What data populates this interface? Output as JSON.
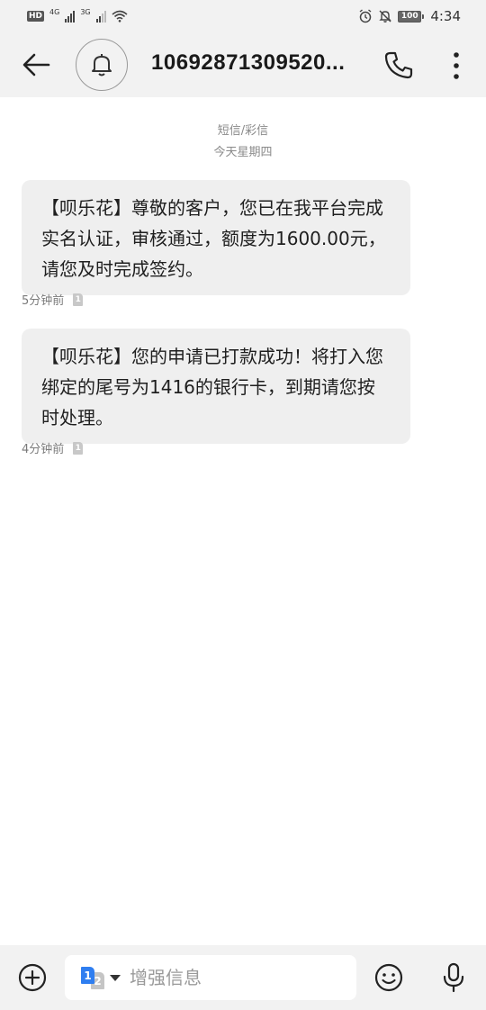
{
  "status_bar": {
    "hd_label": "HD",
    "network_1": "4G",
    "network_2": "3G",
    "battery": "100",
    "time": "4:34"
  },
  "header": {
    "contact_title": "10692871309520..."
  },
  "conversation": {
    "type_label": "短信/彩信",
    "date_label": "今天星期四",
    "messages": [
      {
        "text": "【呗乐花】尊敬的客户，您已在我平台完成实名认证，审核通过，额度为1600.00元，请您及时完成签约。",
        "time": "5分钟前",
        "sim": "1"
      },
      {
        "text": "【呗乐花】您的申请已打款成功！将打入您绑定的尾号为1416的银行卡，到期请您按时处理。",
        "time": "4分钟前",
        "sim": "1"
      }
    ]
  },
  "composer": {
    "placeholder": "增强信息",
    "sim_a": "1",
    "sim_b": "2"
  },
  "icons": {
    "back": "arrow-left-icon",
    "avatar": "bell-icon",
    "call": "phone-icon",
    "more": "more-vertical-icon",
    "add": "plus-circle-icon",
    "emoji": "smiley-icon",
    "mic": "microphone-icon"
  },
  "colors": {
    "bar_background": "#f2f2f2",
    "bubble_background": "#efefef",
    "sim_blue": "#2f7ef0"
  }
}
